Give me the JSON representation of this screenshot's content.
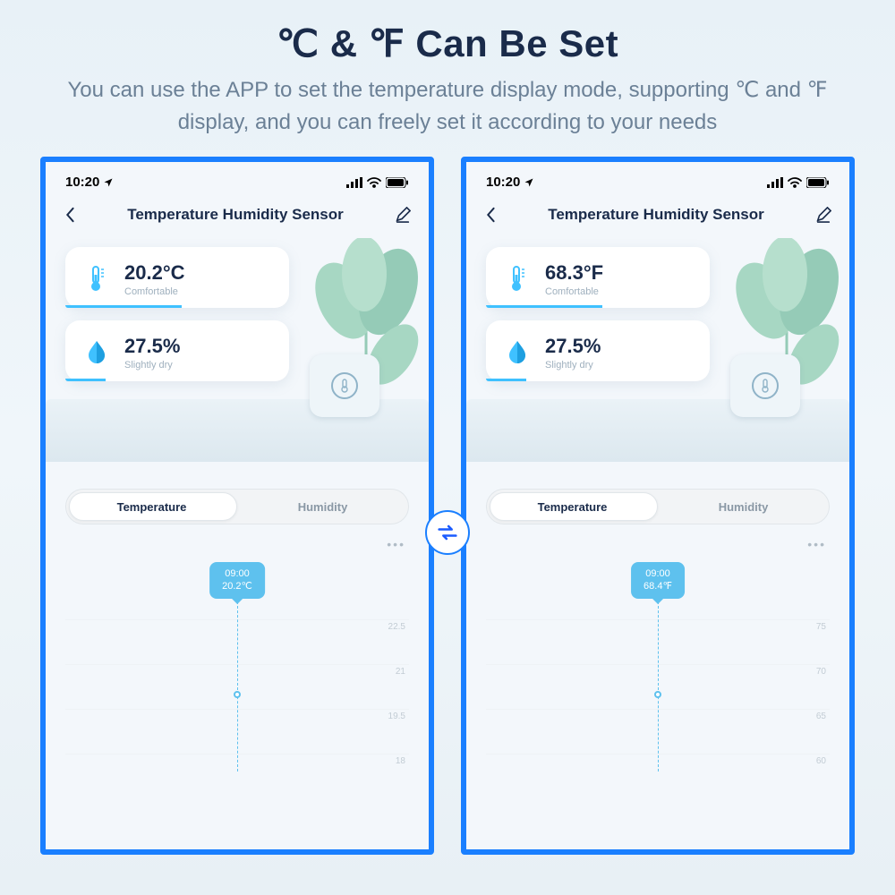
{
  "hero": {
    "title": "℃ & ℉ Can Be Set",
    "subtitle": "You can use the APP to set the temperature display mode, supporting ℃ and ℉ display, and you can freely set it according to your needs"
  },
  "status": {
    "time": "10:20"
  },
  "nav": {
    "title": "Temperature Humidity Sensor"
  },
  "seg": {
    "tab1": "Temperature",
    "tab2": "Humidity",
    "more": "•••"
  },
  "celsius": {
    "temp_value": "20.2°C",
    "temp_label": "Comfortable",
    "hum_value": "27.5%",
    "hum_label": "Slightly dry",
    "tooltip_time": "09:00",
    "tooltip_val": "20.2℃",
    "yticks": [
      "22.5",
      "21",
      "19.5",
      "18"
    ]
  },
  "fahrenheit": {
    "temp_value": "68.3°F",
    "temp_label": "Comfortable",
    "hum_value": "27.5%",
    "hum_label": "Slightly dry",
    "tooltip_time": "09:00",
    "tooltip_val": "68.4℉",
    "yticks": [
      "75",
      "70",
      "65",
      "60"
    ]
  },
  "chart_data": [
    {
      "type": "line",
      "title": "Temperature (°C)",
      "x": [
        "09:00"
      ],
      "values": [
        20.2
      ],
      "ylim": [
        18,
        22.5
      ],
      "yticks": [
        22.5,
        21,
        19.5,
        18
      ],
      "xlabel": "",
      "ylabel": ""
    },
    {
      "type": "line",
      "title": "Temperature (°F)",
      "x": [
        "09:00"
      ],
      "values": [
        68.4
      ],
      "ylim": [
        60,
        75
      ],
      "yticks": [
        75,
        70,
        65,
        60
      ],
      "xlabel": "",
      "ylabel": ""
    }
  ]
}
